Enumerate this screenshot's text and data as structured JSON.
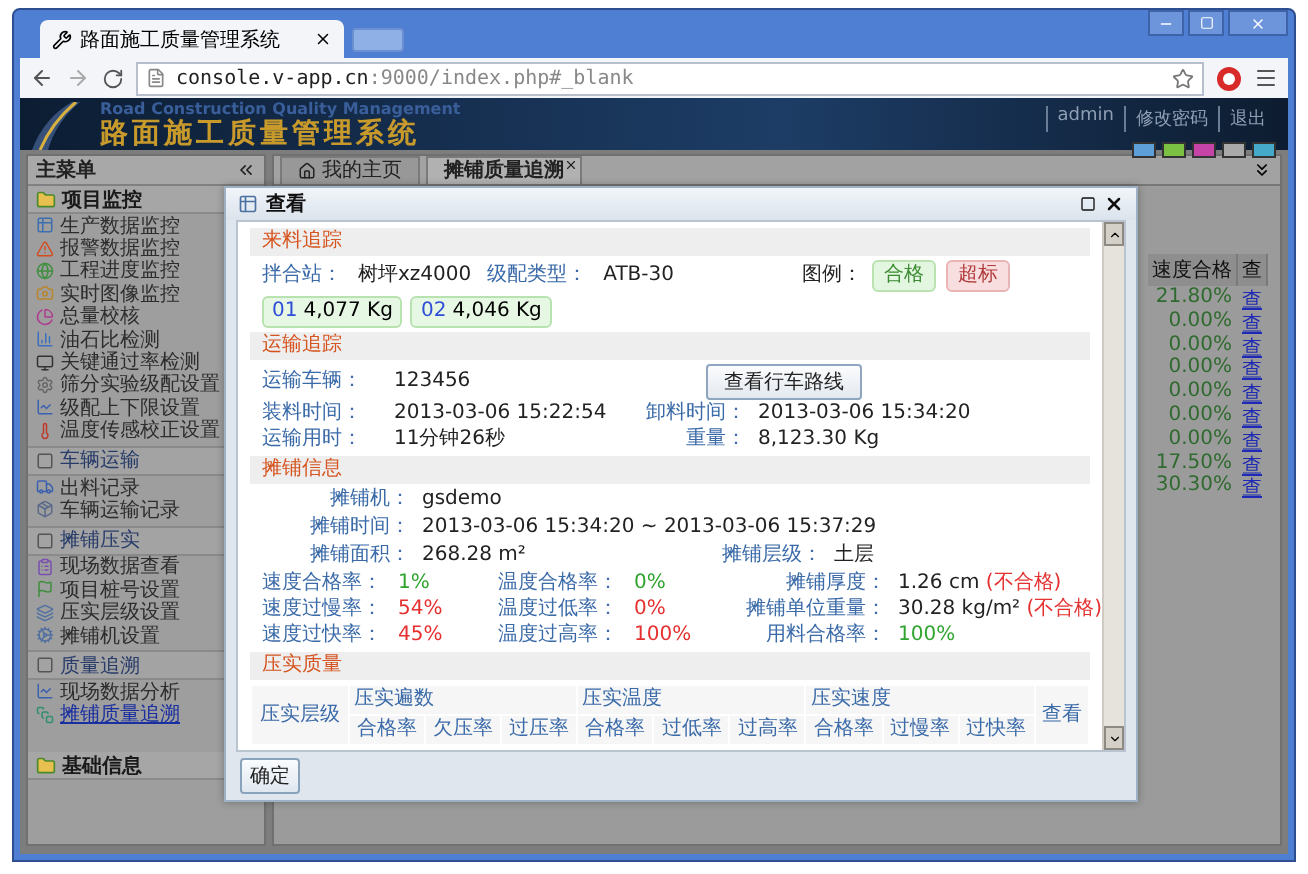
{
  "browser": {
    "tab_title": "路面施工质量管理系统",
    "url_host": "console.v-app.cn",
    "url_rest": ":9000/index.php#_blank"
  },
  "header": {
    "title_en": "Road Construction Quality Management",
    "title_cn": "路面施工质量管理系统",
    "links": [
      "admin",
      "修改密码",
      "退出"
    ],
    "swatches": [
      {
        "color": "#5f9fd8"
      },
      {
        "color": "#7cc043"
      },
      {
        "color": "#c644a8"
      },
      {
        "color": "#a9a9a9"
      },
      {
        "color": "#45a9c9"
      }
    ]
  },
  "sidebar": {
    "title": "主菜单",
    "groups": [
      {
        "label": "项目监控",
        "expanded": true,
        "children": [
          {
            "kind": "item",
            "label": "生产数据监控",
            "selected": false
          },
          {
            "kind": "item",
            "label": "报警数据监控",
            "selected": false
          },
          {
            "kind": "item",
            "label": "工程进度监控",
            "selected": false
          },
          {
            "kind": "item",
            "label": "实时图像监控",
            "selected": false
          },
          {
            "kind": "item",
            "label": "总量校核",
            "selected": false
          },
          {
            "kind": "item",
            "label": "油石比检测",
            "selected": false
          },
          {
            "kind": "item",
            "label": "关键通过率检测",
            "selected": false
          },
          {
            "kind": "item",
            "label": "筛分实验级配设置",
            "selected": false
          },
          {
            "kind": "item",
            "label": "级配上下限设置",
            "selected": false
          },
          {
            "kind": "item",
            "label": "温度传感校正设置",
            "selected": false
          },
          {
            "kind": "section",
            "label": "车辆运输",
            "children": [
              {
                "kind": "item",
                "label": "出料记录",
                "selected": false
              },
              {
                "kind": "item",
                "label": "车辆运输记录",
                "selected": false
              }
            ]
          },
          {
            "kind": "section",
            "label": "摊铺压实",
            "children": [
              {
                "kind": "item",
                "label": "现场数据查看",
                "selected": false
              },
              {
                "kind": "item",
                "label": "项目桩号设置",
                "selected": false
              },
              {
                "kind": "item",
                "label": "压实层级设置",
                "selected": false
              },
              {
                "kind": "item",
                "label": "摊铺机设置",
                "selected": false
              }
            ]
          },
          {
            "kind": "section",
            "label": "质量追溯",
            "children": [
              {
                "kind": "item",
                "label": "现场数据分析",
                "selected": false
              },
              {
                "kind": "item",
                "label": "摊铺质量追溯",
                "selected": true
              }
            ]
          }
        ]
      },
      {
        "label": "基础信息",
        "expanded": false
      }
    ]
  },
  "tabs": [
    {
      "label": "我的主页",
      "selected": false,
      "closable": false
    },
    {
      "label": "摊铺质量追溯",
      "selected": true,
      "closable": true
    }
  ],
  "background_table": {
    "column_1": "速度合格",
    "column_2": "查",
    "rows": [
      {
        "value": "21.80%",
        "link": "查"
      },
      {
        "value": "0.00%",
        "link": "查"
      },
      {
        "value": "0.00%",
        "link": "查"
      },
      {
        "value": "0.00%",
        "link": "查"
      },
      {
        "value": "0.00%",
        "link": "查"
      },
      {
        "value": "0.00%",
        "link": "查"
      },
      {
        "value": "0.00%",
        "link": "查"
      },
      {
        "value": "17.50%",
        "link": "查"
      },
      {
        "value": "30.30%",
        "link": "查"
      }
    ]
  },
  "dialog": {
    "title": "查看",
    "material": {
      "heading": "来料追踪",
      "fields": [
        {
          "label": "拌合站：",
          "value": "树坪xz4000"
        },
        {
          "label": "级配类型：",
          "value": "ATB-30"
        }
      ],
      "legend_label": "图例：",
      "legend": [
        {
          "label": "合格",
          "qualified": true
        },
        {
          "label": "超标",
          "qualified": false
        }
      ],
      "chips": [
        {
          "number": "01",
          "weight": "4,077 Kg",
          "qualified": true
        },
        {
          "number": "02",
          "weight": "4,046 Kg",
          "qualified": true
        }
      ]
    },
    "transport": {
      "heading": "运输追踪",
      "vehicle_label": "运输车辆：",
      "vehicle": "123456",
      "route_button": "查看行车路线",
      "fields": [
        {
          "label": "装料时间：",
          "value": "2013-03-06 15:22:54"
        },
        {
          "label": "卸料时间：",
          "value": "2013-03-06 15:34:20"
        },
        {
          "label": "运输用时：",
          "value": "11分钟26秒"
        },
        {
          "label": "重量：",
          "value": "8,123.30 Kg"
        }
      ]
    },
    "paving": {
      "heading": "摊铺信息",
      "machine_label": "摊铺机：",
      "machine": "gsdemo",
      "time_label": "摊铺时间：",
      "time": "2013-03-06 15:34:20 ~ 2013-03-06 15:37:29",
      "area_label": "摊铺面积：",
      "area": "268.28 m²",
      "layer_label": "摊铺层级：",
      "layer": "土层",
      "metrics": [
        {
          "label": "速度合格率：",
          "value": "1%",
          "qualified": true
        },
        {
          "label": "温度合格率：",
          "value": "0%",
          "qualified": true
        },
        {
          "label": "摊铺厚度：",
          "value": "1.26 cm",
          "note": "(不合格)"
        },
        {
          "label": "速度过慢率：",
          "value": "54%",
          "qualified": false
        },
        {
          "label": "温度过低率：",
          "value": "0%",
          "qualified": false
        },
        {
          "label": "摊铺单位重量：",
          "value": "30.28 kg/m²",
          "note": "(不合格)"
        },
        {
          "label": "速度过快率：",
          "value": "45%",
          "qualified": false
        },
        {
          "label": "温度过高率：",
          "value": "100%",
          "qualified": false
        },
        {
          "label": "用料合格率：",
          "value": "100%",
          "qualified": true
        }
      ]
    },
    "compaction": {
      "heading": "压实质量",
      "layer_column": "压实层级",
      "view_column": "查看",
      "groups": [
        {
          "label": "压实遍数",
          "columns": [
            "合格率",
            "欠压率",
            "过压率"
          ]
        },
        {
          "label": "压实温度",
          "columns": [
            "合格率",
            "过低率",
            "过高率"
          ]
        },
        {
          "label": "压实速度",
          "columns": [
            "合格率",
            "过慢率",
            "过快率"
          ]
        }
      ]
    },
    "ok_button": "确定"
  }
}
